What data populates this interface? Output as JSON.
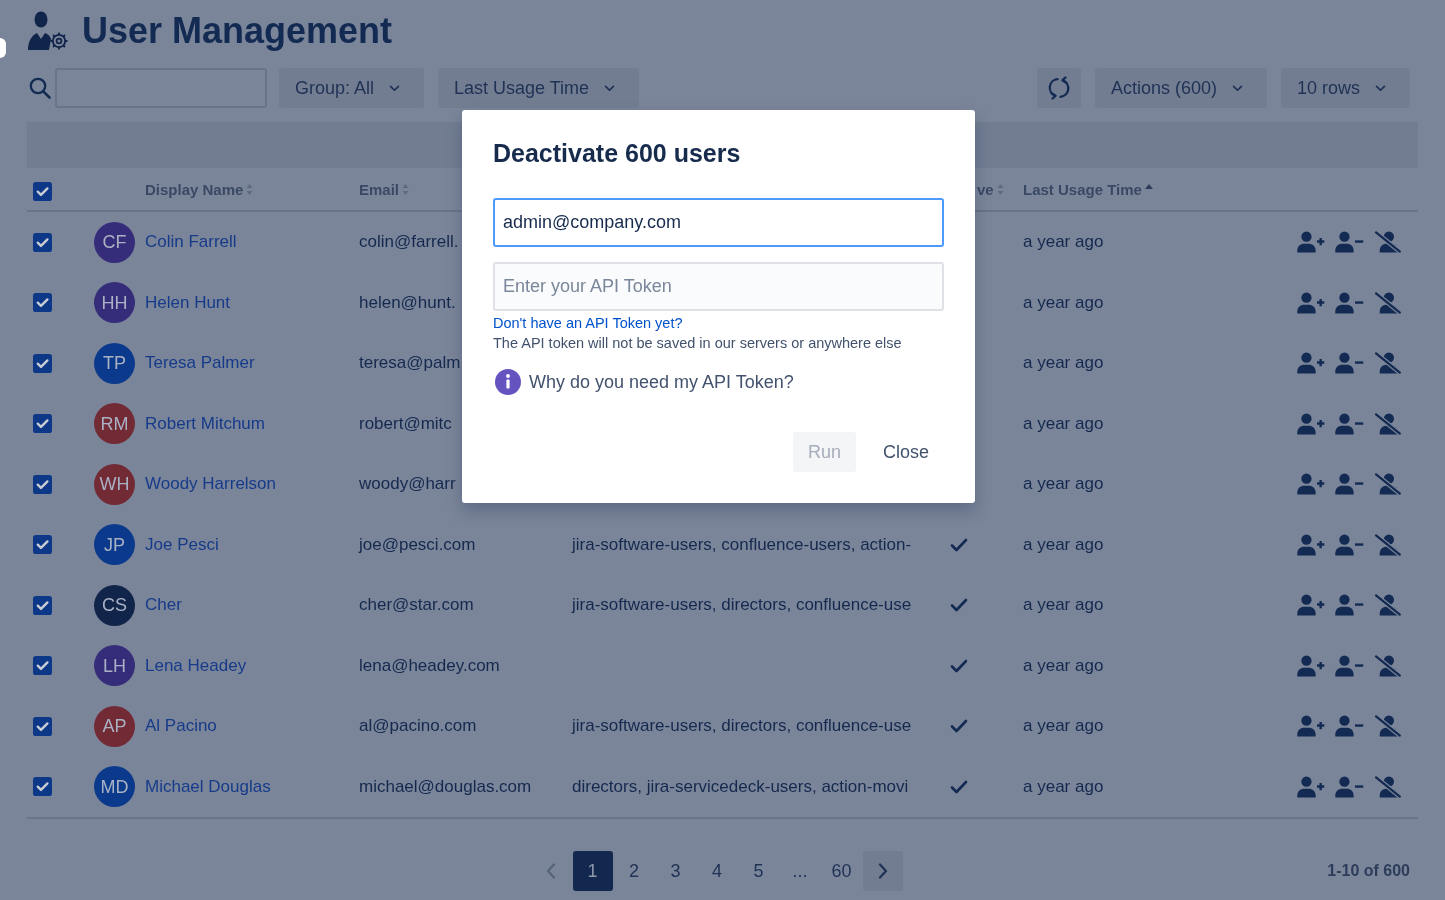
{
  "page": {
    "title": "User Management"
  },
  "toolbar": {
    "filters": [
      "Group: All",
      "Last Usage Time"
    ],
    "menus": [
      "Actions (600)",
      "10 rows"
    ]
  },
  "table": {
    "select_all": {
      "checked": true
    },
    "columns": [
      {
        "label": "Display Name",
        "sorted": false
      },
      {
        "label": "Email",
        "sorted": false
      },
      {
        "label": "ve",
        "sorted": false
      },
      {
        "label": "Last Usage Time",
        "sorted": true
      }
    ],
    "rows": [
      {
        "checked": true,
        "initials": "CF",
        "color": "#352d7a",
        "name": "Colin Farrell",
        "email": "colin@farrell.",
        "last_usage": "a year ago"
      },
      {
        "checked": true,
        "initials": "HH",
        "color": "#352d7a",
        "name": "Helen Hunt",
        "email": "helen@hunt.",
        "last_usage": "a year ago"
      },
      {
        "checked": true,
        "initials": "TP",
        "color": "#0b3a8c",
        "name": "Teresa Palmer",
        "email": "teresa@palm",
        "last_usage": "a year ago"
      },
      {
        "checked": true,
        "initials": "RM",
        "color": "#722a35",
        "name": "Robert Mitchum",
        "email": "robert@mitc",
        "last_usage": "a year ago"
      },
      {
        "checked": true,
        "initials": "WH",
        "color": "#722a35",
        "name": "Woody Harrelson",
        "email": "woody@harr",
        "last_usage": "a year ago"
      },
      {
        "checked": true,
        "initials": "JP",
        "color": "#0b3a8c",
        "name": "Joe Pesci",
        "email": "joe@pesci.com",
        "groups": "jira-software-users, confluence-users, action-",
        "active": true,
        "last_usage": "a year ago"
      },
      {
        "checked": true,
        "initials": "CS",
        "color": "#11244a",
        "name": "Cher",
        "email": "cher@star.com",
        "groups": "jira-software-users, directors, confluence-use",
        "active": true,
        "last_usage": "a year ago"
      },
      {
        "checked": true,
        "initials": "LH",
        "color": "#352d7a",
        "name": "Lena Headey",
        "email": "lena@headey.com",
        "active": true,
        "last_usage": "a year ago"
      },
      {
        "checked": true,
        "initials": "AP",
        "color": "#722a35",
        "name": "Al Pacino",
        "email": "al@pacino.com",
        "groups": "jira-software-users, directors, confluence-use",
        "active": true,
        "last_usage": "a year ago"
      },
      {
        "checked": true,
        "initials": "MD",
        "color": "#0b3a8c",
        "name": "Michael Douglas",
        "email": "michael@douglas.com",
        "groups": "directors, jira-servicedeck-users, action-movi",
        "active": true,
        "last_usage": "a year ago"
      }
    ]
  },
  "pagination": {
    "prev": {
      "disabled": true
    },
    "pages": [
      {
        "kind": "page",
        "label": "1",
        "selected": true
      },
      {
        "kind": "page",
        "label": "2",
        "selected": false
      },
      {
        "kind": "page",
        "label": "3",
        "selected": false
      },
      {
        "kind": "page",
        "label": "4",
        "selected": false
      },
      {
        "kind": "page",
        "label": "5",
        "selected": false
      },
      {
        "kind": "gap",
        "label": "..."
      },
      {
        "kind": "page",
        "label": "60",
        "selected": false
      }
    ],
    "next": {
      "disabled": false
    },
    "summary": "1-10 of 600"
  },
  "dialog": {
    "title": "Deactivate 600 users",
    "email_field": {
      "value": "admin@company.com",
      "focused": true
    },
    "token_field": {
      "placeholder": "Enter your API Token",
      "focused": false
    },
    "help_link": "Don't have an API Token yet?",
    "note": "The API token will not be saved in our servers or anywhere else",
    "info": "Why do you need my API Token?",
    "buttons": [
      {
        "label": "Run",
        "kind": "primary",
        "disabled": true
      },
      {
        "label": "Close",
        "kind": "subtle",
        "disabled": false
      }
    ]
  }
}
